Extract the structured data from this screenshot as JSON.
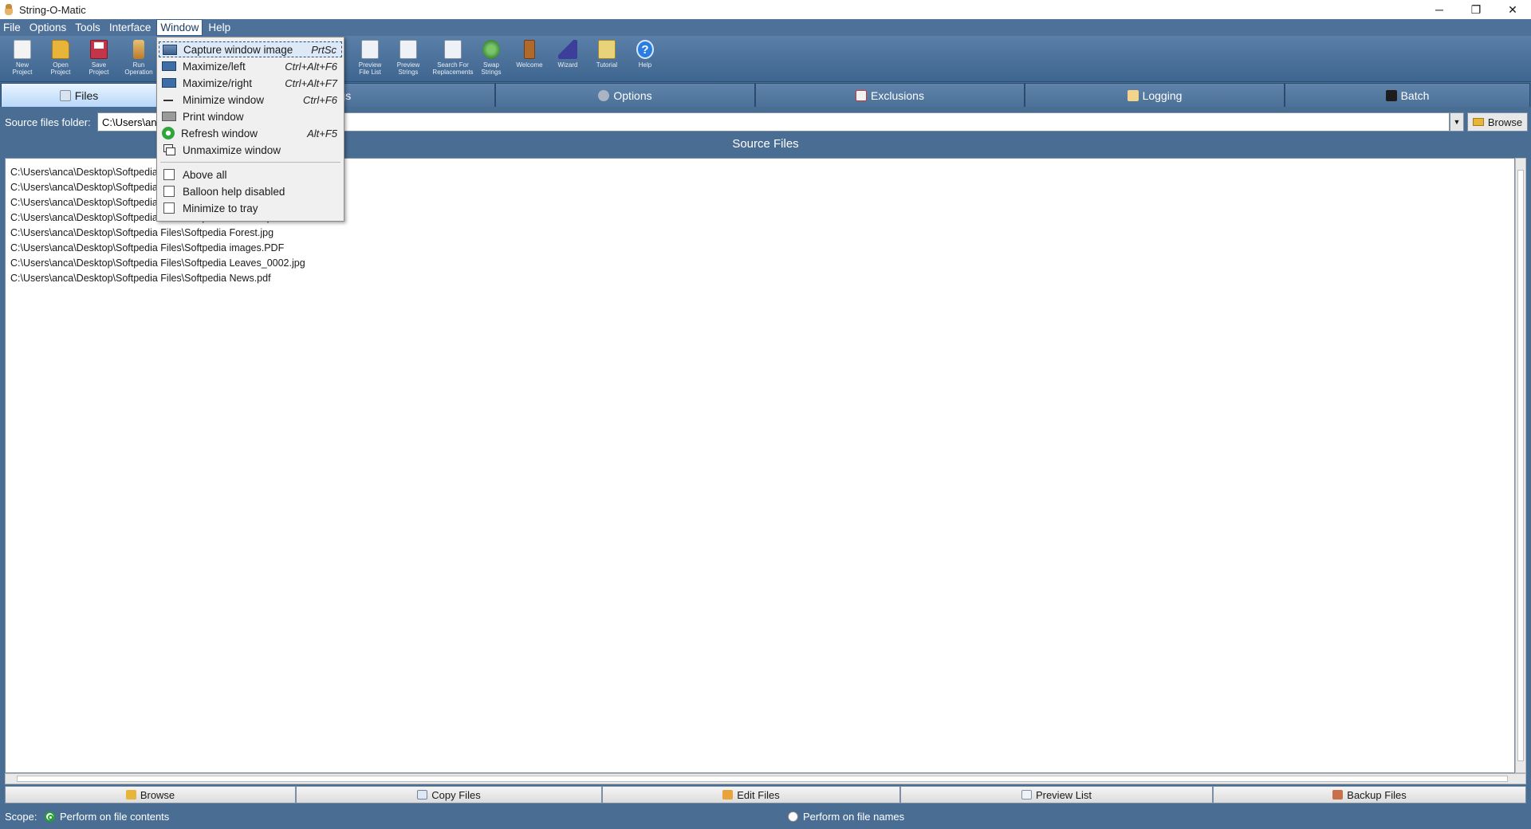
{
  "window": {
    "title": "String-O-Matic",
    "min": "─",
    "restore": "❐",
    "close": "✕"
  },
  "menubar": [
    "File",
    "Options",
    "Tools",
    "Interface",
    "Window",
    "Help"
  ],
  "toolbar": [
    {
      "label": "New\nProject",
      "icon": "new-project-icon"
    },
    {
      "label": "Open\nProject",
      "icon": "open-project-icon"
    },
    {
      "label": "Save\nProject",
      "icon": "save-project-icon"
    },
    {
      "label": "Run\nOperation",
      "icon": "run-operation-icon"
    },
    {
      "label": "Preview\nFile List",
      "icon": "preview-file-list-icon"
    },
    {
      "label": "Preview\nStrings",
      "icon": "preview-strings-icon"
    },
    {
      "label": "Search For\nReplacements",
      "icon": "search-replacements-icon"
    },
    {
      "label": "Swap\nStrings",
      "icon": "swap-strings-icon"
    },
    {
      "label": "Welcome",
      "icon": "welcome-icon"
    },
    {
      "label": "Wizard",
      "icon": "wizard-icon"
    },
    {
      "label": "Tutorial",
      "icon": "tutorial-icon"
    },
    {
      "label": "Help",
      "icon": "help-icon"
    }
  ],
  "tabs": [
    "Files",
    "Strings",
    "Options",
    "Exclusions",
    "Logging",
    "Batch"
  ],
  "source": {
    "label": "Source files folder:",
    "value": "C:\\Users\\anca\\Desktop\\Softpedia Files",
    "browse": "Browse",
    "section_title": "Source Files"
  },
  "files": [
    "C:\\Users\\anca\\Desktop\\Softpedia Files\\Softpedia Chart.xlsx",
    "C:\\Users\\anca\\Desktop\\Softpedia Files\\Softpedia Doc.docx",
    "C:\\Users\\anca\\Desktop\\Softpedia Files\\Softpedia Flower.jpg",
    "C:\\Users\\anca\\Desktop\\Softpedia Files\\Softpedia Folder.zip",
    "C:\\Users\\anca\\Desktop\\Softpedia Files\\Softpedia Forest.jpg",
    "C:\\Users\\anca\\Desktop\\Softpedia Files\\Softpedia images.PDF",
    "C:\\Users\\anca\\Desktop\\Softpedia Files\\Softpedia Leaves_0002.jpg",
    "C:\\Users\\anca\\Desktop\\Softpedia Files\\Softpedia News.pdf"
  ],
  "bottom_buttons": [
    "Browse",
    "Copy Files",
    "Edit Files",
    "Preview List",
    "Backup Files"
  ],
  "scope": {
    "label": "Scope:",
    "option_contents": "Perform on file contents",
    "option_names": "Perform on file names",
    "selected": "contents"
  },
  "window_menu": {
    "items": [
      {
        "label": "Capture window image",
        "shortcut": "PrtSc",
        "icon": "camera-icon"
      },
      {
        "label": "Maximize/left",
        "shortcut": "Ctrl+Alt+F6",
        "icon": "maximize-left-icon"
      },
      {
        "label": "Maximize/right",
        "shortcut": "Ctrl+Alt+F7",
        "icon": "maximize-right-icon"
      },
      {
        "label": "Minimize window",
        "shortcut": "Ctrl+F6",
        "icon": "minimize-icon"
      },
      {
        "label": "Print window",
        "shortcut": "",
        "icon": "printer-icon"
      },
      {
        "label": "Refresh window",
        "shortcut": "Alt+F5",
        "icon": "refresh-icon"
      },
      {
        "label": "Unmaximize window",
        "shortcut": "",
        "icon": "unmaximize-icon"
      }
    ],
    "checks": [
      "Above all",
      "Balloon help disabled",
      "Minimize to tray"
    ]
  },
  "colors": {
    "frame": "#4a6d93",
    "active_tab": "#b8d8fa",
    "radio_checked": "#22a034"
  }
}
